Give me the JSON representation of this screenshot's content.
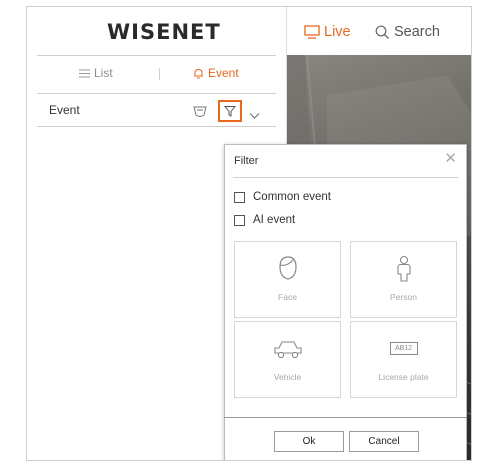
{
  "brand": {
    "logo_text": "WISENET"
  },
  "nav": {
    "live_label": "Live",
    "search_label": "Search",
    "accent_color": "#e8681e"
  },
  "tabs": {
    "list_label": "List",
    "event_label": "Event"
  },
  "event_bar": {
    "label": "Event"
  },
  "filter_dialog": {
    "title": "Filter",
    "checkboxes": [
      {
        "label": "Common event",
        "checked": false
      },
      {
        "label": "AI event",
        "checked": false
      }
    ],
    "cards": [
      {
        "label": "Face",
        "icon": "face-icon"
      },
      {
        "label": "Person",
        "icon": "person-icon"
      },
      {
        "label": "Vehicle",
        "icon": "vehicle-icon"
      },
      {
        "label": "License plate",
        "icon": "license-plate-icon",
        "plate_text": "AB12"
      }
    ],
    "ok_label": "Ok",
    "cancel_label": "Cancel"
  }
}
